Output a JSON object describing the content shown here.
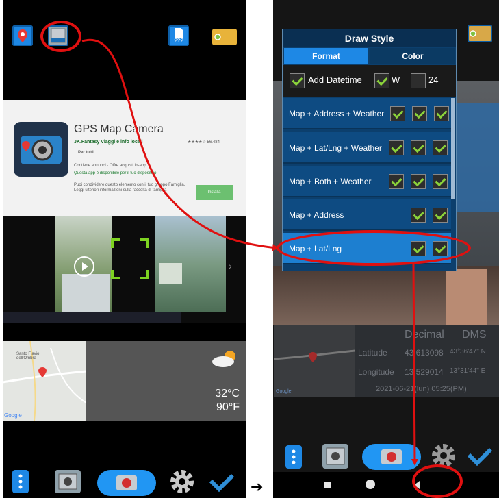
{
  "left_screen": {
    "toolbar": {
      "location_icon": "location-pin-icon",
      "style_icon": "draw-style-icon",
      "file_label": "???"
    },
    "store_listing": {
      "app_title": "GPS Map Camera",
      "developer": "JK.Fantasy   Viaggi e info locali",
      "rating": "★★★★☆ 56.484",
      "audience": "Per tutti",
      "ads_line": "Contiene annunci · Offre acquisti in-app",
      "compat_line": "Questa app è disponibile per il tuo dispositivo",
      "share_line": "Puoi condividere questo elemento con il tuo gruppo Famiglia. Leggi ulteriori informazioni sulla raccolta di famiglia",
      "install_label": "Installa"
    },
    "map_labels": {
      "place": "Santo Flavio dell'Ombra",
      "logo": "Google"
    },
    "weather": {
      "temp_c": "32°C",
      "temp_f": "90°F"
    }
  },
  "dialog": {
    "title": "Draw Style",
    "tabs": [
      "Format",
      "Color"
    ],
    "options": {
      "datetime_label": "Add Datetime",
      "w_label": "W",
      "hour_label": "24"
    },
    "rows": [
      {
        "label": "Map + Address + Weather",
        "checks": 3
      },
      {
        "label": "Map + Lat/Lng + Weather",
        "checks": 3
      },
      {
        "label": "Map + Both + Weather",
        "checks": 3
      },
      {
        "label": "Map + Address",
        "checks": 2
      },
      {
        "label": "Map + Lat/Lng",
        "checks": 2
      }
    ]
  },
  "right_screen": {
    "coord_table": {
      "headers": [
        "Decimal",
        "DMS"
      ],
      "latitude_label": "Latitude",
      "latitude_decimal": "43.613098",
      "latitude_dms": "43°36'47\" N",
      "longitude_label": "Longitude",
      "longitude_decimal": "13.529014",
      "longitude_dms": "13°31'44\" E",
      "datetime": "2021-06-21(lun)  05:25(PM)"
    },
    "map_logo": "Google"
  },
  "arrow_glyph": "➔",
  "colors": {
    "accent_blue": "#1e88e5",
    "highlight_red": "#e01010",
    "check_green": "#8bd33a"
  }
}
